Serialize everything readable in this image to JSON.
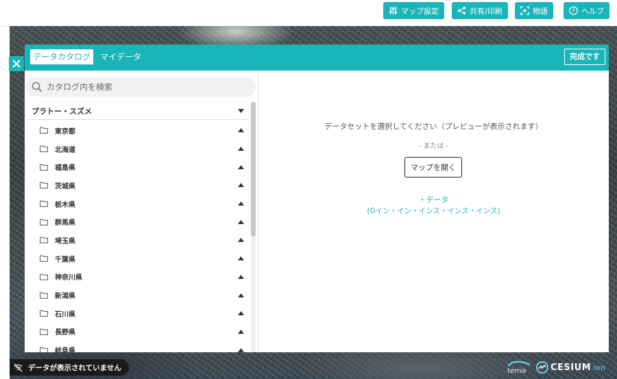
{
  "toolbar": {
    "map_settings": "マップ設定",
    "share_print": "共有/印刷",
    "story": "物語",
    "help": "ヘルプ"
  },
  "colors": {
    "accent": "#1ab5b8"
  },
  "catalog": {
    "tab_active": "データカタログ",
    "tab_my_data": "マイデータ",
    "done_button": "完成です",
    "search_placeholder": "カタログ内を検索",
    "group_title": "プラトー・スズメ",
    "items": [
      "東京都",
      "北海道",
      "福島県",
      "茨城県",
      "栃木県",
      "群馬県",
      "埼玉県",
      "千葉県",
      "神奈川県",
      "新潟県",
      "石川県",
      "長野県",
      "岐阜県"
    ]
  },
  "preview": {
    "prompt": "データセットを選択してください（プレビューが表示されます）",
    "or": "- または -",
    "open_map": "マップを開く",
    "link1": "・データ",
    "link2": "(Gイン・イン・インス・インス・インス)"
  },
  "footer": {
    "no_data": "データが表示されていません",
    "terria": "terria",
    "cesium": "CESIUM",
    "ion": "ion"
  }
}
